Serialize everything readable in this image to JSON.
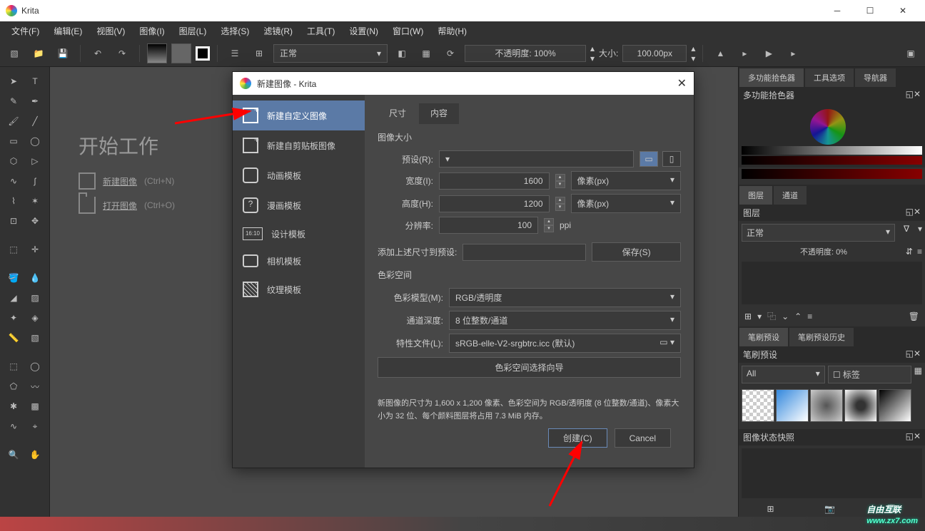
{
  "app": {
    "title": "Krita"
  },
  "menu": [
    "文件(F)",
    "编辑(E)",
    "视图(V)",
    "图像(I)",
    "图层(L)",
    "选择(S)",
    "滤镜(R)",
    "工具(T)",
    "设置(N)",
    "窗口(W)",
    "帮助(H)"
  ],
  "toolbar": {
    "blend": "正常",
    "opacity_label": "不透明度: 100%",
    "size_label": "大小:",
    "size_value": "100.00px"
  },
  "start": {
    "title": "开始工作",
    "newimg": "新建图像",
    "newimg_short": "(Ctrl+N)",
    "openimg": "打开图像",
    "openimg_short": "(Ctrl+O)"
  },
  "right": {
    "tab1": "多功能拾色器",
    "tab2": "工具选项",
    "tab3": "导航器",
    "picker_title": "多功能拾色器",
    "layers_tab1": "图层",
    "layers_tab2": "通道",
    "layers_title": "图层",
    "layers_blend": "正常",
    "layers_opacity": "不透明度:   0%",
    "presets_tab1": "笔刷预设",
    "presets_tab2": "笔刷预设历史",
    "presets_title": "笔刷预设",
    "presets_filter": "All",
    "presets_tag": "标签",
    "snapshot": "图像状态快照"
  },
  "dialog": {
    "title": "新建图像 - Krita",
    "sidebar": {
      "custom": "新建自定义图像",
      "clipboard": "新建自剪贴板图像",
      "anim": "动画模板",
      "comic": "漫画模板",
      "design": "设计模板",
      "camera": "相机模板",
      "texture": "纹理模板",
      "design_badge": "16:10"
    },
    "tab1": "尺寸",
    "tab2": "内容",
    "section_size": "图像大小",
    "preset": "预设(R):",
    "width": "宽度(I):",
    "width_val": "1600",
    "height": "高度(H):",
    "height_val": "1200",
    "px_unit": "像素(px)",
    "res": "分辨率:",
    "res_val": "100",
    "res_unit": "ppi",
    "addpreset": "添加上述尺寸到预设:",
    "save": "保存(S)",
    "section_color": "色彩空间",
    "model": "色彩模型(M):",
    "model_val": "RGB/透明度",
    "depth": "通道深度:",
    "depth_val": "8 位整数/通道",
    "profile": "特性文件(L):",
    "profile_val": "sRGB-elle-V2-srgbtrc.icc (默认)",
    "wizard": "色彩空间选择向导",
    "info": "新图像的尺寸为 1,600 x 1,200 像素、色彩空间为 RGB/透明度 (8 位整数/通道)、像素大小为 32 位、每个颜料图层将占用 7.3 MiB 内存。",
    "create": "创建(C)",
    "cancel": "Cancel"
  },
  "watermark": {
    "main": "自由互联",
    "sub": "www.zx7.com"
  }
}
